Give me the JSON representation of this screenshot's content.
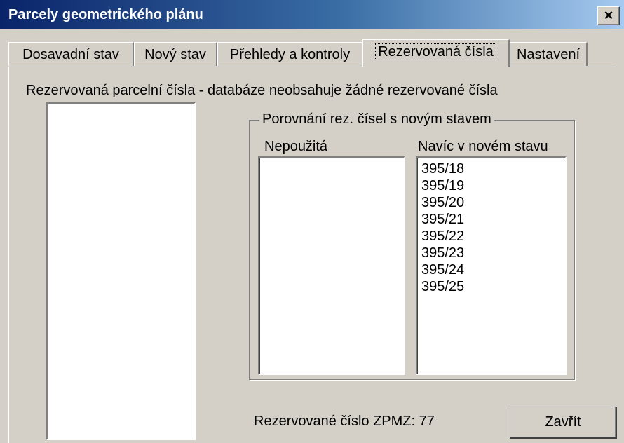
{
  "window": {
    "title": "Parcely geometrického plánu",
    "close_glyph": "×"
  },
  "tabs": [
    {
      "label": "Dosavadní stav",
      "active": false
    },
    {
      "label": "Nový stav",
      "active": false
    },
    {
      "label": "Přehledy a kontroly",
      "active": false
    },
    {
      "label": "Rezervovaná čísla",
      "active": true
    },
    {
      "label": "Nastavení",
      "active": false
    }
  ],
  "panel": {
    "heading": "Rezervovaná parcelní čísla - databáze neobsahuje žádné rezervované čísla",
    "group": {
      "legend": "Porovnání rez. čísel s novým stavem",
      "unused_label": "Nepoužitá",
      "extra_label": "Navíc v novém stavu",
      "extra_items": [
        "395/18",
        "395/19",
        "395/20",
        "395/21",
        "395/22",
        "395/23",
        "395/24",
        "395/25"
      ]
    },
    "zpmz_text": "Rezervované číslo ZPMZ: 77",
    "close_button": "Zavřít"
  },
  "colors": {
    "face": "#d4d0c8",
    "title_start": "#0a246a",
    "title_end": "#a6caf0"
  }
}
